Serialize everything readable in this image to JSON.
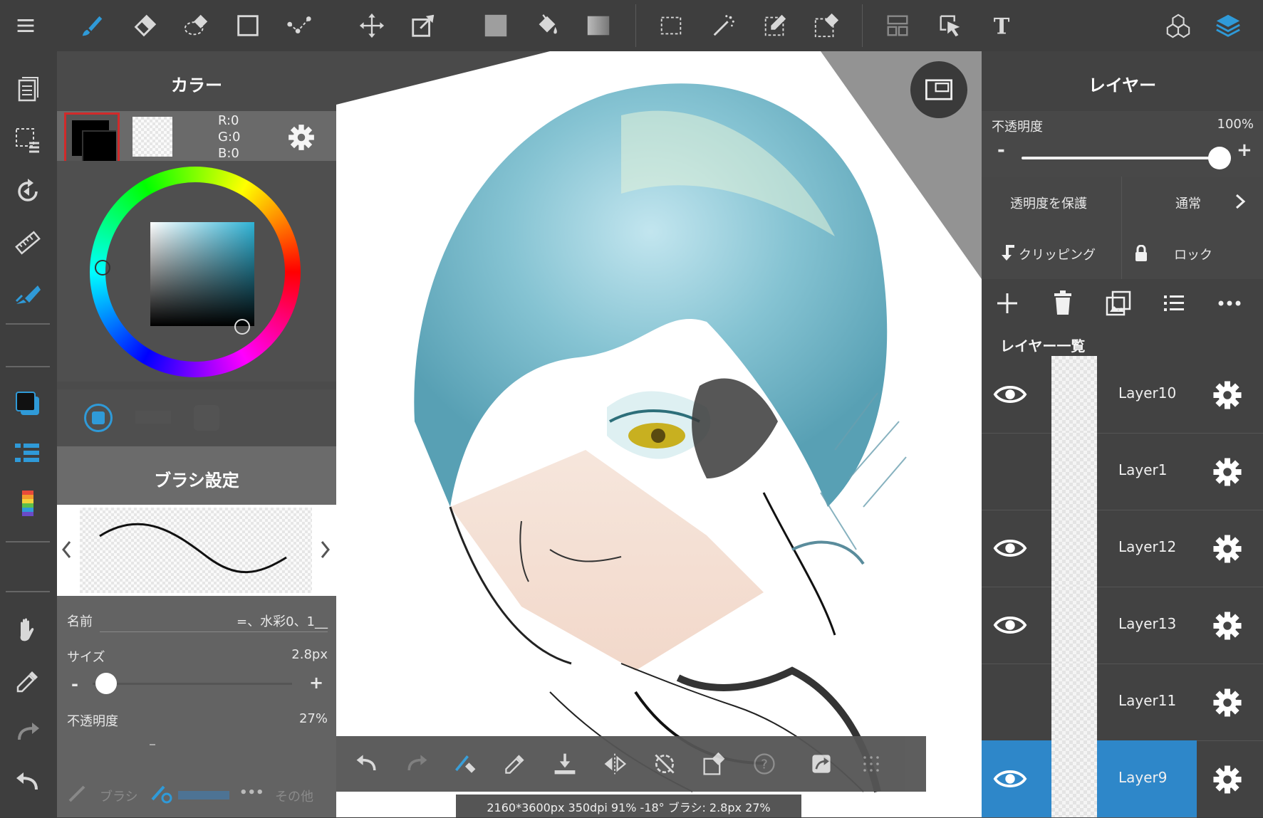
{
  "toolbar": {
    "tools": [
      "menu-icon",
      "brush-icon",
      "eraser-icon",
      "lasso-eraser-icon",
      "rectangle-icon",
      "dot-line-icon",
      "move-icon",
      "transform-icon",
      "fill-color-icon",
      "bucket-icon",
      "gradient-icon",
      "select-rect-icon",
      "magic-wand-icon",
      "select-pen-icon",
      "select-eraser-icon",
      "panel-layout-icon",
      "select-cursor-icon",
      "text-icon",
      "materials-icon",
      "layers-icon"
    ]
  },
  "color_panel": {
    "title": "カラー",
    "r": "R:0",
    "g": "G:0",
    "b": "B:0",
    "primary_color": "#000000",
    "wheel_hue_color": "#2fb3d6"
  },
  "brush_panel": {
    "title": "ブラシ設定",
    "name_label": "名前",
    "name_value": "=、水彩0、1__",
    "size_label": "サイズ",
    "size_value": "2.8px",
    "size_minus": "-",
    "size_plus": "+",
    "opacity_label": "不透明度",
    "opacity_value": "27%",
    "tab_brush": "ブラシ",
    "tab_other": "その他"
  },
  "layer_panel": {
    "title": "レイヤー",
    "opacity_label": "不透明度",
    "opacity_value": "100%",
    "opacity_minus": "-",
    "opacity_plus": "+",
    "protect_alpha": "透明度を保護",
    "blend_mode": "通常",
    "clipping": "クリッピング",
    "lock": "ロック",
    "list_title": "レイヤー一覧",
    "layers": [
      {
        "name": "Layer10",
        "visible": true,
        "selected": false
      },
      {
        "name": "Layer1",
        "visible": false,
        "selected": false
      },
      {
        "name": "Layer12",
        "visible": true,
        "selected": false
      },
      {
        "name": "Layer13",
        "visible": true,
        "selected": false
      },
      {
        "name": "Layer11",
        "visible": false,
        "selected": false
      },
      {
        "name": "Layer9",
        "visible": true,
        "selected": true
      }
    ],
    "selected_color": "#2e87c9"
  },
  "status": {
    "text": "2160*3600px 350dpi 91% -18° ブラシ: 2.8px 27%"
  },
  "accent": "#2f9ad8"
}
